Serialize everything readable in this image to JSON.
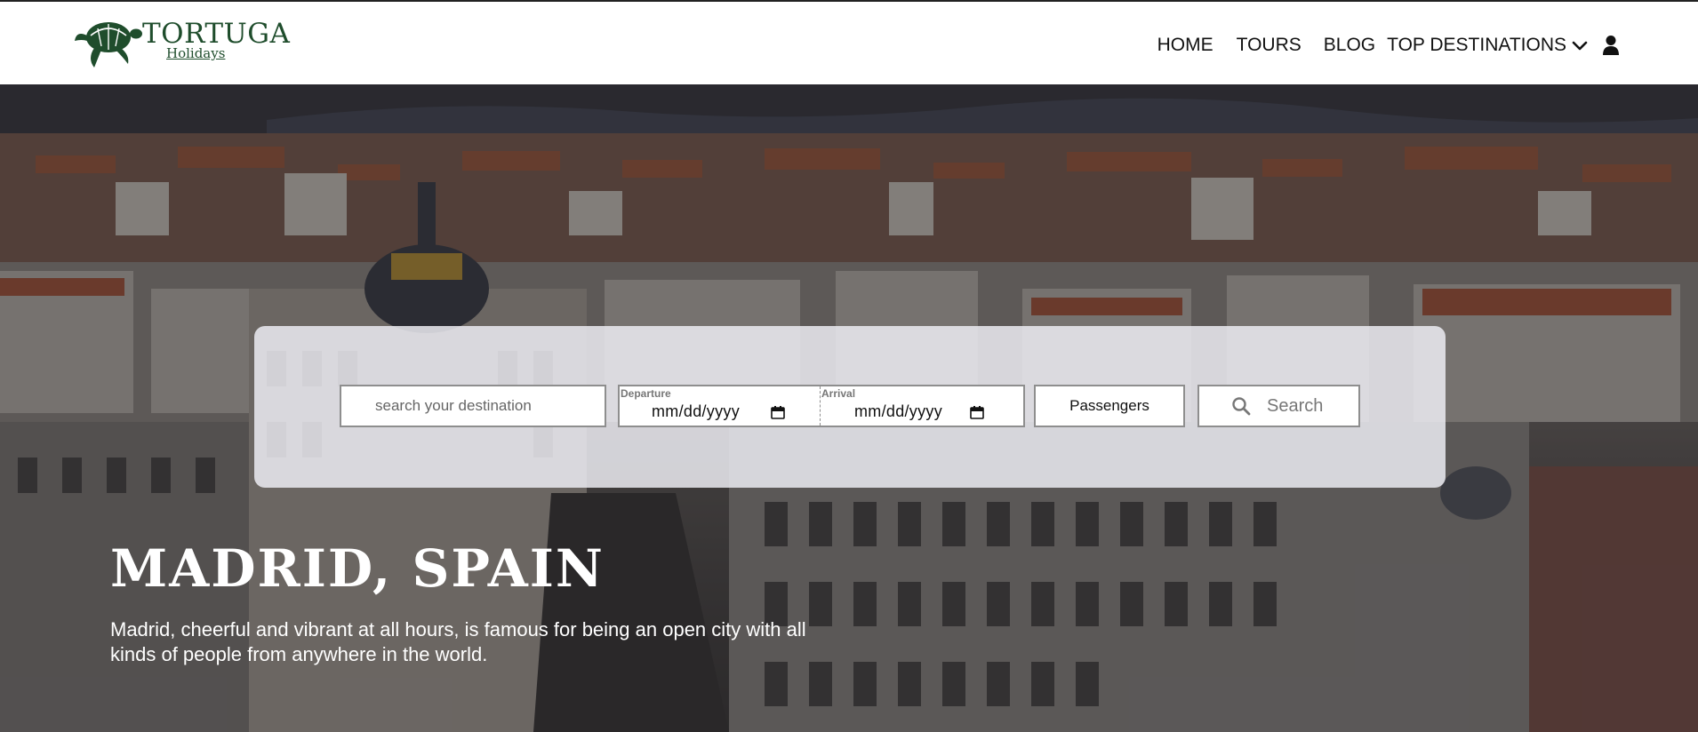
{
  "brand": {
    "name": "TORTUGA",
    "sub": "Holidays",
    "color": "#1f4d2c"
  },
  "nav": {
    "home": "HOME",
    "tours": "TOURS",
    "blog": "BLOG",
    "top_destinations": "TOP DESTINATIONS",
    "icons": [
      "chevron-down-icon",
      "user-icon"
    ]
  },
  "search": {
    "destination_placeholder": "search your destination",
    "departure_label": "Departure",
    "departure_value": "mm/dd/yyyy",
    "arrival_label": "Arrival",
    "arrival_value": "mm/dd/yyyy",
    "passengers_label": "Passengers",
    "search_label": "Search",
    "icons": [
      "calendar-icon",
      "search-icon"
    ]
  },
  "hero": {
    "title": "MADRID, SPAIN",
    "description": "Madrid, cheerful and vibrant at all hours, is famous for being an open city with all kinds of people from anywhere in the world."
  }
}
